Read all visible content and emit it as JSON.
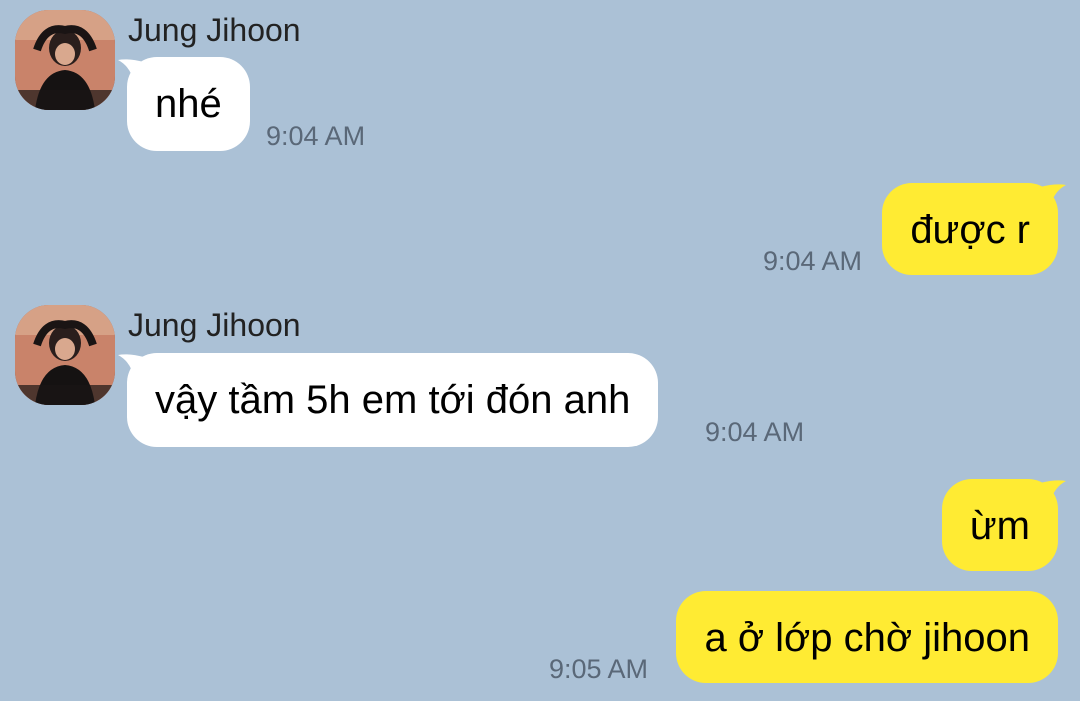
{
  "messages": [
    {
      "direction": "incoming",
      "sender": "Jung Jihoon",
      "text": "nhé",
      "time": "9:04 AM",
      "avatar_icon": "user-avatar-photo"
    },
    {
      "direction": "outgoing",
      "text": "được r",
      "time": "9:04 AM"
    },
    {
      "direction": "incoming",
      "sender": "Jung Jihoon",
      "text": "vậy tầm 5h em tới đón anh",
      "time": "9:04 AM",
      "avatar_icon": "user-avatar-photo"
    },
    {
      "direction": "outgoing",
      "text": "ừm",
      "time": ""
    },
    {
      "direction": "outgoing",
      "text": "a ở lớp chờ jihoon",
      "time": "9:05 AM"
    }
  ],
  "colors": {
    "background": "#abc1d6",
    "incoming_bubble": "#ffffff",
    "outgoing_bubble": "#ffeb33",
    "timestamp": "#5a6878"
  }
}
